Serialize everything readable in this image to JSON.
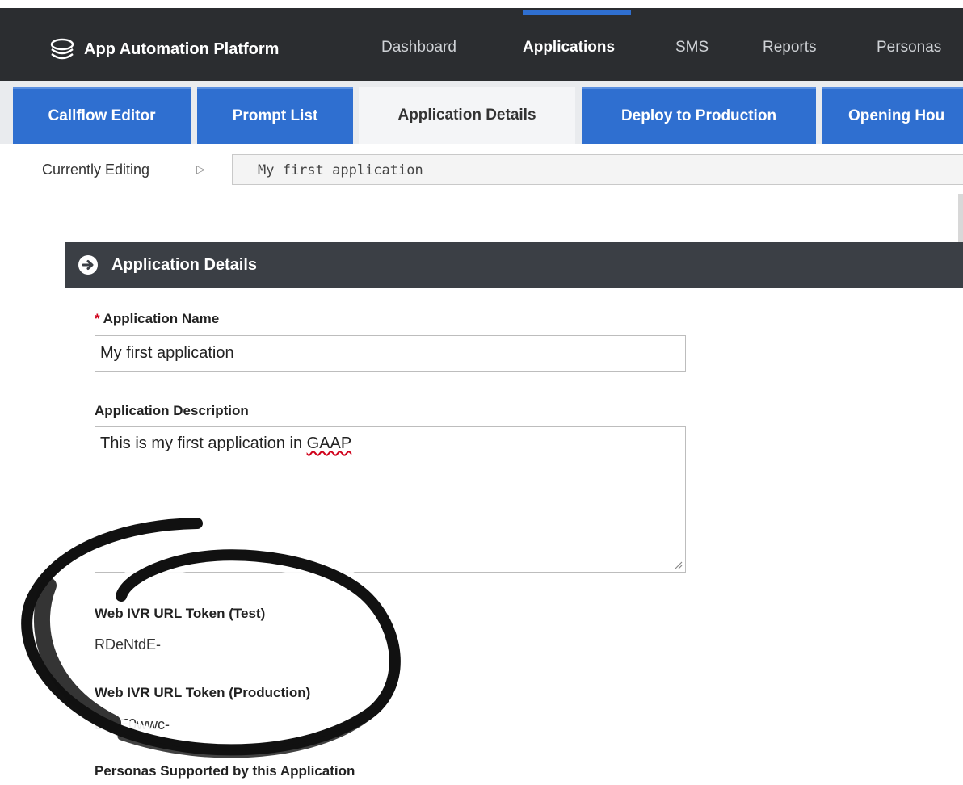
{
  "header": {
    "app_title": "App Automation Platform",
    "nav": [
      "Dashboard",
      "Applications",
      "SMS",
      "Reports",
      "Personas"
    ],
    "active_nav": "Applications"
  },
  "subtabs": [
    "Callflow Editor",
    "Prompt List",
    "Application Details",
    "Deploy to Production",
    "Opening Hou"
  ],
  "active_subtab": "Application Details",
  "editing": {
    "label": "Currently Editing",
    "value": "My first application"
  },
  "section": {
    "title": "Application Details"
  },
  "form": {
    "name_required_mark": "*",
    "name_label": "Application Name",
    "name_value": "My first application",
    "description_label": "Application Description",
    "description_prefix": "This is my first application in ",
    "description_flagged_word": "GAAP",
    "token_test_label": "Web IVR URL Token (Test)",
    "token_test_value": "RDeNtdE-",
    "token_prod_label": "Web IVR URL Token (Production)",
    "token_prod_value": "DWE0wwc-",
    "personas_label": "Personas Supported by this Application"
  },
  "colors": {
    "topbar": "#2b2d30",
    "tab_blue": "#2f6fd0",
    "section_header": "#3b3f45",
    "required": "#d0021b"
  },
  "icons": {
    "brand": "stacked-layers-icon",
    "section": "circle-arrow-right-icon",
    "editing_arrow": "triangle-right-outline-icon"
  }
}
